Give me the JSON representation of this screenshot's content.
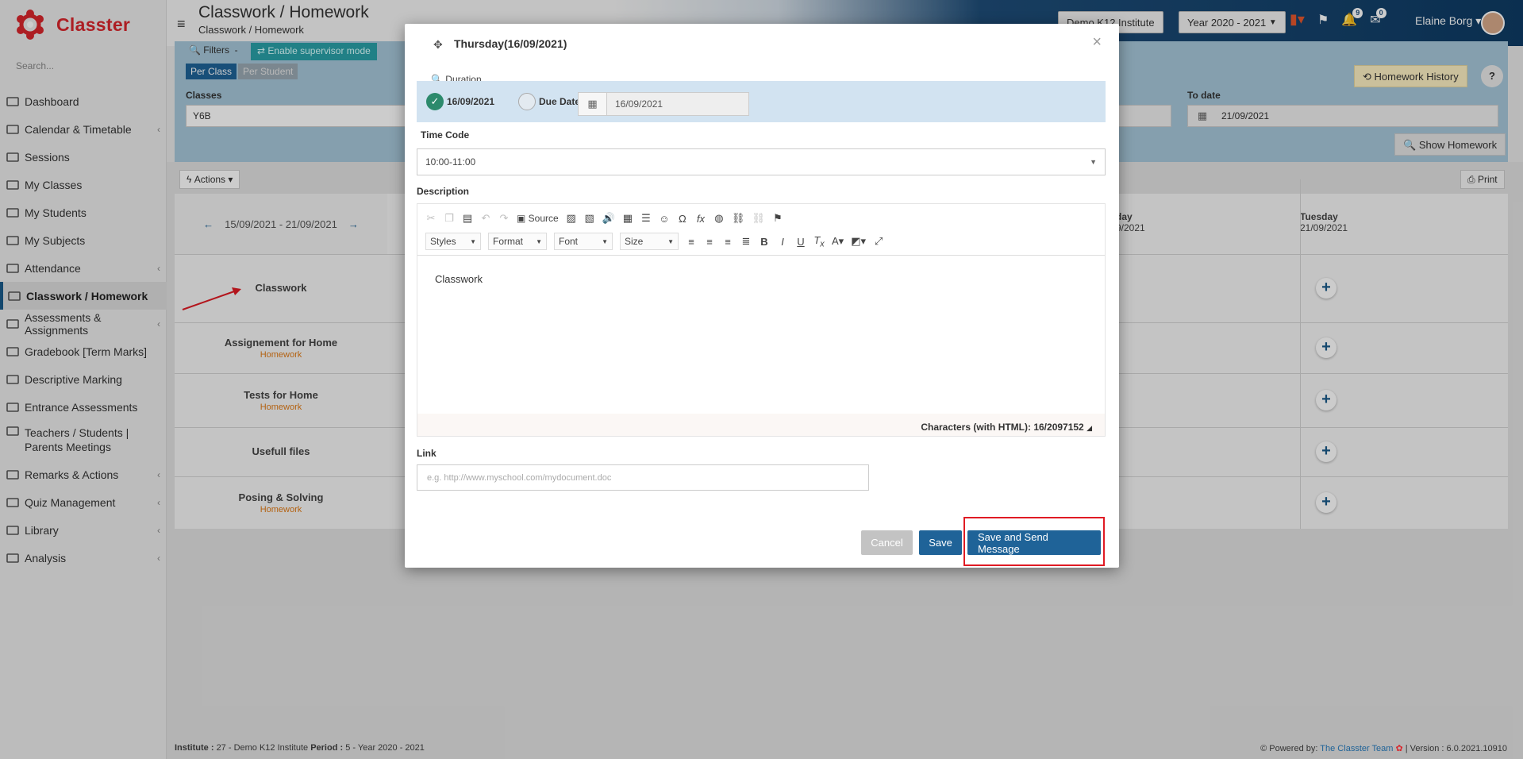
{
  "app": {
    "name": "Classter"
  },
  "sidebar": {
    "search_placeholder": "Search...",
    "items": [
      {
        "label": "Dashboard",
        "icon": "dashboard-icon"
      },
      {
        "label": "Calendar & Timetable",
        "icon": "calendar-icon",
        "chevron": "‹"
      },
      {
        "label": "Sessions",
        "icon": "sessions-icon"
      },
      {
        "label": "My Classes",
        "icon": "classes-icon"
      },
      {
        "label": "My Students",
        "icon": "students-icon"
      },
      {
        "label": "My Subjects",
        "icon": "subjects-icon"
      },
      {
        "label": "Attendance",
        "icon": "attendance-icon",
        "chevron": "‹"
      },
      {
        "label": "Classwork / Homework",
        "icon": "homework-icon",
        "active": true
      },
      {
        "label": "Assessments & Assignments",
        "icon": "assessments-icon",
        "chevron": "‹"
      },
      {
        "label": "Gradebook [Term Marks]",
        "icon": "gradebook-icon"
      },
      {
        "label": "Descriptive Marking",
        "icon": "descriptive-icon"
      },
      {
        "label": "Entrance Assessments",
        "icon": "entrance-icon"
      },
      {
        "label": "Teachers / Students | Parents Meetings",
        "icon": "meetings-icon"
      },
      {
        "label": "Remarks & Actions",
        "icon": "remarks-icon",
        "chevron": "‹"
      },
      {
        "label": "Quiz Management",
        "icon": "quiz-icon",
        "chevron": "‹"
      },
      {
        "label": "Library",
        "icon": "library-icon",
        "chevron": "‹"
      },
      {
        "label": "Analysis",
        "icon": "analysis-icon",
        "chevron": "‹"
      }
    ]
  },
  "header": {
    "title": "Classwork / Homework",
    "breadcrumb": "Classwork / Homework",
    "institute": "Demo K12 Institute",
    "year": "Year 2020 - 2021",
    "notif_count": "9",
    "msg_count": "0",
    "user_name": "Elaine Borg"
  },
  "filters": {
    "filters_label": "Filters",
    "supervisor_label": "Enable supervisor mode",
    "per_class": "Per Class",
    "per_student": "Per Student",
    "classes_label": "Classes",
    "classes_value": "Y6B",
    "to_date_label": "To date",
    "to_date_value": "21/09/2021",
    "history_label": "Homework History",
    "help_label": "?",
    "show_label": "Show Homework",
    "actions_label": "Actions",
    "print_label": "Print"
  },
  "grid": {
    "week_range": "15/09/2021 - 21/09/2021",
    "partial_day": "day",
    "partial_date": "9/2021",
    "last_day": "Tuesday",
    "last_date": "21/09/2021",
    "rows": [
      {
        "label": "Classwork",
        "sub": ""
      },
      {
        "label": "Assignement for Home",
        "sub": "Homework"
      },
      {
        "label": "Tests for Home",
        "sub": "Homework"
      },
      {
        "label": "Usefull files",
        "sub": ""
      },
      {
        "label": "Posing & Solving",
        "sub": "Homework"
      }
    ]
  },
  "modal": {
    "title": "Thursday(16/09/2021)",
    "close": "×",
    "duration_label": "Duration",
    "option_date": "16/09/2021",
    "option_due": "Due Date",
    "due_value": "16/09/2021",
    "time_code_label": "Time Code",
    "time_code_value": "10:00-11:00",
    "description_label": "Description",
    "source_label": "Source",
    "styles": "Styles",
    "format": "Format",
    "font": "Font",
    "size": "Size",
    "editor_text": "Classwork",
    "char_count": "Characters (with HTML): 16/2097152",
    "link_label": "Link",
    "link_placeholder": "e.g. http://www.myschool.com/mydocument.doc",
    "cancel": "Cancel",
    "save": "Save",
    "save_send": "Save and Send Message"
  },
  "footer": {
    "left_institute_label": "Institute :",
    "left_institute_value": "27 - Demo K12 Institute",
    "left_period_label": "Period :",
    "left_period_value": "5 - Year 2020 - 2021",
    "powered_label": "Powered by:",
    "powered_team": "The Classter Team",
    "version": "| Version : 6.0.2021.10910"
  },
  "colors": {
    "brand_red": "#d9262c",
    "primary_blue": "#1f6398",
    "highlight_red": "#e01b24",
    "homework_orange": "#e07b17"
  }
}
